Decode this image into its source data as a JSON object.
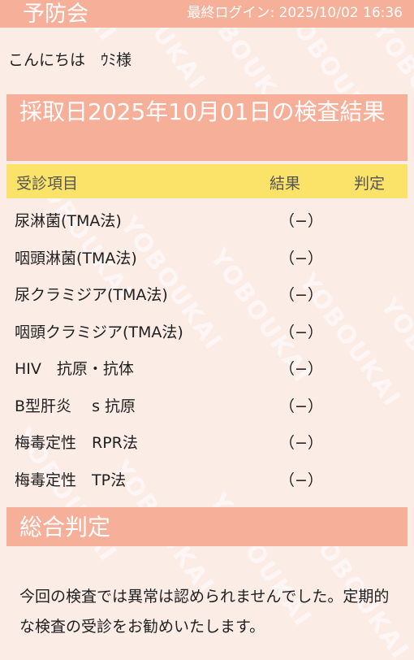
{
  "header": {
    "brand": "予防会",
    "last_login": "最終ログイン: 2025/10/02 16:36"
  },
  "greeting": "こんにちは　ｳﾐ様",
  "result_title": "採取日2025年10月01日の検査結果",
  "table": {
    "headers": {
      "item": "受診項目",
      "result": "結果",
      "judgement": "判定"
    },
    "rows": [
      {
        "item": "尿淋菌(TMA法)",
        "result": "（−）",
        "judgement": ""
      },
      {
        "item": "咽頭淋菌(TMA法)",
        "result": "（−）",
        "judgement": ""
      },
      {
        "item": "尿クラミジア(TMA法)",
        "result": "（−）",
        "judgement": ""
      },
      {
        "item": "咽頭クラミジア(TMA法)",
        "result": "（−）",
        "judgement": ""
      },
      {
        "item": "HIV　抗原・抗体",
        "result": "（−）",
        "judgement": ""
      },
      {
        "item": "B型肝炎　 s 抗原",
        "result": "（−）",
        "judgement": ""
      },
      {
        "item": "梅毒定性　RPR法",
        "result": "（−）",
        "judgement": ""
      },
      {
        "item": "梅毒定性　TP法",
        "result": "（−）",
        "judgement": ""
      }
    ]
  },
  "overall": {
    "heading": "総合判定",
    "message": "今回の検査では異常は認められませんでした。定期的な検査の受診をお勧めいたします。"
  },
  "watermark": "YOBOUKAI",
  "colors": {
    "header_bg": "#f6b09a",
    "table_header_bg": "#fbe36a",
    "page_bg": "#fbece6"
  }
}
